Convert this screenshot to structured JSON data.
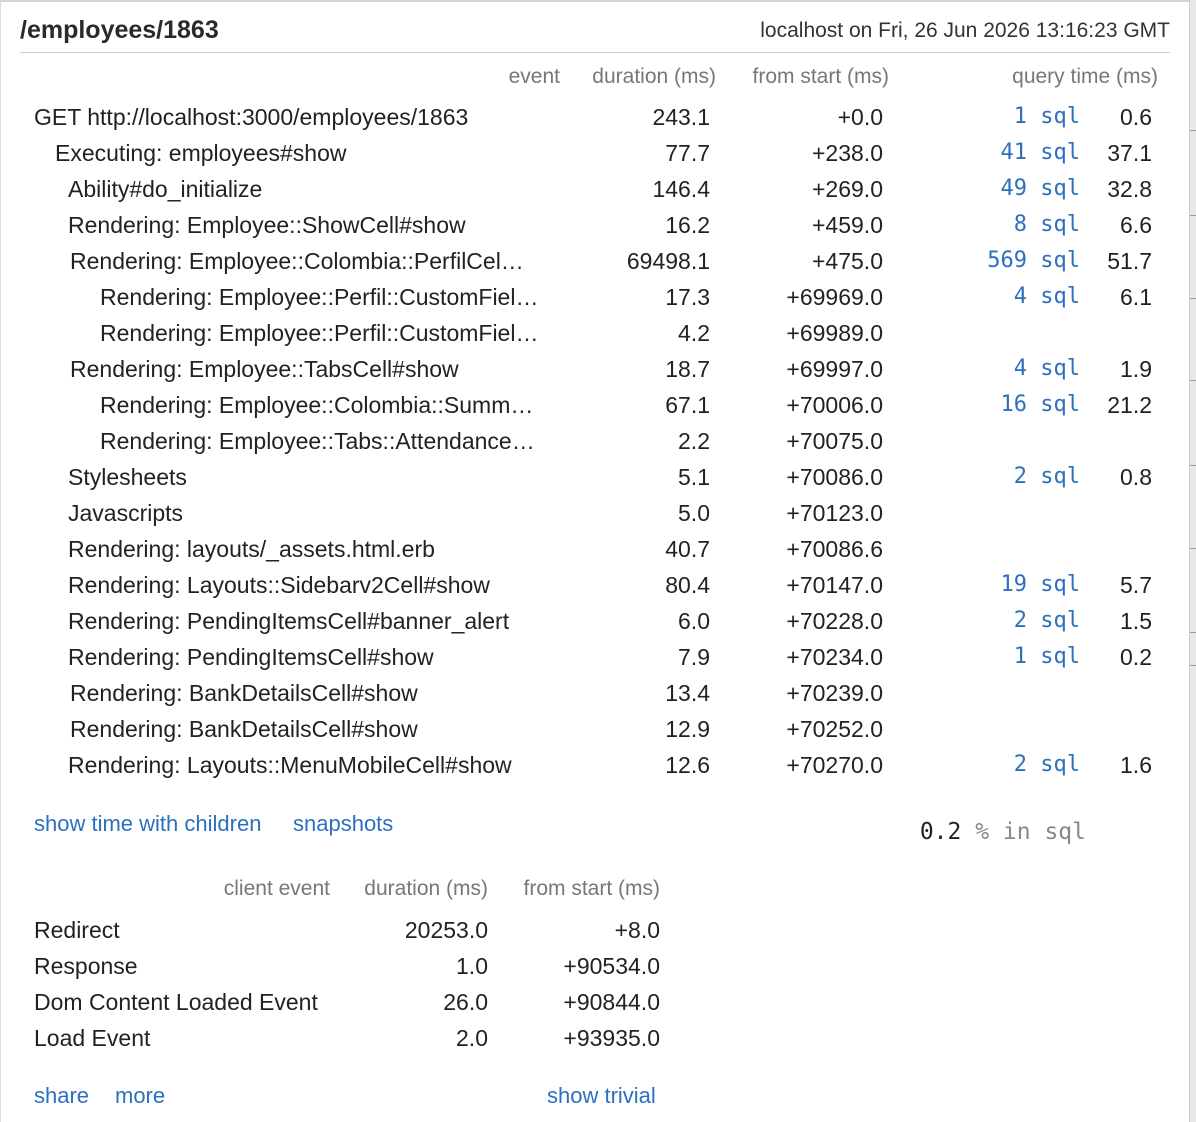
{
  "header": {
    "title": "/employees/1863",
    "machine": "localhost on Fri, 26 Jun 2026 13:16:23 GMT"
  },
  "timing_headers": {
    "event": "event",
    "duration": "duration (ms)",
    "from_start": "from start (ms)",
    "query_time": "query time (ms)"
  },
  "timings": [
    {
      "name": "GET http://localhost:3000/employees/1863",
      "indent": 0,
      "duration": "243.1",
      "from_start": "+0.0",
      "sql": "1 sql",
      "query_time": "0.6"
    },
    {
      "name": "Executing: employees#show",
      "indent": 1,
      "duration": "77.7",
      "from_start": "+238.0",
      "sql": "41 sql",
      "query_time": "37.1"
    },
    {
      "name": "Ability#do_initialize",
      "indent": 2,
      "duration": "146.4",
      "from_start": "+269.0",
      "sql": "49 sql",
      "query_time": "32.8"
    },
    {
      "name": "Rendering: Employee::ShowCell#show",
      "indent": 2,
      "duration": "16.2",
      "from_start": "+459.0",
      "sql": "8 sql",
      "query_time": "6.6"
    },
    {
      "name": "Rendering: Employee::Colombia::PerfilCel…",
      "indent": 3,
      "duration": "69498.1",
      "from_start": "+475.0",
      "sql": "569 sql",
      "query_time": "51.7"
    },
    {
      "name": "Rendering: Employee::Perfil::CustomFiel…",
      "indent": 4,
      "duration": "17.3",
      "from_start": "+69969.0",
      "sql": "4 sql",
      "query_time": "6.1"
    },
    {
      "name": "Rendering: Employee::Perfil::CustomFiel…",
      "indent": 4,
      "duration": "4.2",
      "from_start": "+69989.0",
      "sql": "",
      "query_time": ""
    },
    {
      "name": "Rendering: Employee::TabsCell#show",
      "indent": 3,
      "duration": "18.7",
      "from_start": "+69997.0",
      "sql": "4 sql",
      "query_time": "1.9"
    },
    {
      "name": "Rendering: Employee::Colombia::Summ…",
      "indent": 4,
      "duration": "67.1",
      "from_start": "+70006.0",
      "sql": "16 sql",
      "query_time": "21.2"
    },
    {
      "name": "Rendering: Employee::Tabs::Attendance…",
      "indent": 4,
      "duration": "2.2",
      "from_start": "+70075.0",
      "sql": "",
      "query_time": ""
    },
    {
      "name": "Stylesheets",
      "indent": 2,
      "duration": "5.1",
      "from_start": "+70086.0",
      "sql": "2 sql",
      "query_time": "0.8"
    },
    {
      "name": "Javascripts",
      "indent": 2,
      "duration": "5.0",
      "from_start": "+70123.0",
      "sql": "",
      "query_time": ""
    },
    {
      "name": "Rendering: layouts/_assets.html.erb",
      "indent": 2,
      "duration": "40.7",
      "from_start": "+70086.6",
      "sql": "",
      "query_time": ""
    },
    {
      "name": "Rendering: Layouts::Sidebarv2Cell#show",
      "indent": 2,
      "duration": "80.4",
      "from_start": "+70147.0",
      "sql": "19 sql",
      "query_time": "5.7"
    },
    {
      "name": "Rendering: PendingItemsCell#banner_alert",
      "indent": 2,
      "duration": "6.0",
      "from_start": "+70228.0",
      "sql": "2 sql",
      "query_time": "1.5"
    },
    {
      "name": "Rendering: PendingItemsCell#show",
      "indent": 2,
      "duration": "7.9",
      "from_start": "+70234.0",
      "sql": "1 sql",
      "query_time": "0.2"
    },
    {
      "name": "Rendering: BankDetailsCell#show",
      "indent": 3,
      "duration": "13.4",
      "from_start": "+70239.0",
      "sql": "",
      "query_time": ""
    },
    {
      "name": "Rendering: BankDetailsCell#show",
      "indent": 3,
      "duration": "12.9",
      "from_start": "+70252.0",
      "sql": "",
      "query_time": ""
    },
    {
      "name": "Rendering: Layouts::MenuMobileCell#show",
      "indent": 2,
      "duration": "12.6",
      "from_start": "+70270.0",
      "sql": "2 sql",
      "query_time": "1.6"
    }
  ],
  "links": {
    "show_children": "show time with children",
    "snapshots": "snapshots",
    "share": "share",
    "more": "more",
    "show_trivial": "show trivial"
  },
  "sql_percent": {
    "value": "0.2",
    "label": "% in sql"
  },
  "client_headers": {
    "event": "client event",
    "duration": "duration (ms)",
    "from_start": "from start (ms)"
  },
  "client_timings": [
    {
      "name": "Redirect",
      "duration": "20253.0",
      "from_start": "+8.0"
    },
    {
      "name": "Response",
      "duration": "1.0",
      "from_start": "+90534.0"
    },
    {
      "name": "Dom Content Loaded Event",
      "duration": "26.0",
      "from_start": "+90844.0"
    },
    {
      "name": "Load Event",
      "duration": "2.0",
      "from_start": "+93935.0"
    }
  ]
}
